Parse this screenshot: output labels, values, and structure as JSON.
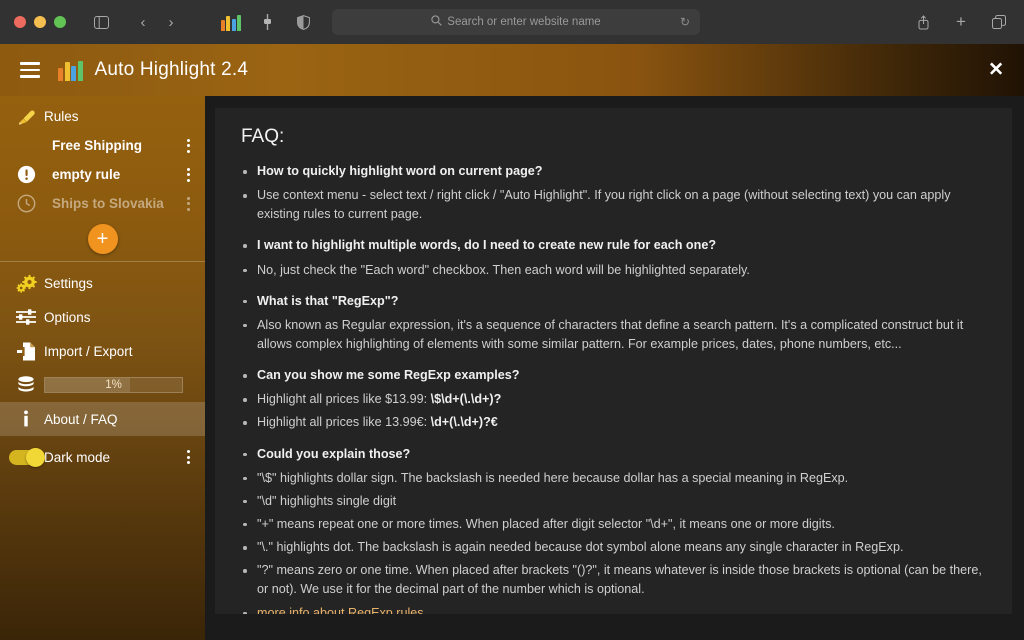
{
  "browser": {
    "search_placeholder": "Search or enter website name",
    "icons": {
      "search": "search-icon",
      "reload": "reload-icon",
      "sidebar": "sidebar-toggle-icon",
      "back": "back-arrow-icon",
      "forward": "forward-arrow-icon",
      "extension_highlighter": "highlighter-extension-icon",
      "extension_slider": "slider-extension-icon",
      "extension_shield": "shield-extension-icon",
      "share": "share-icon",
      "new_tab": "plus-icon",
      "tabs": "tab-overview-icon"
    }
  },
  "app": {
    "title": "Auto Highlight 2.4",
    "menu_label": "menu",
    "close_label": "✕"
  },
  "sidebar": {
    "rules_header": "Rules",
    "rules": [
      {
        "label": "Free Shipping",
        "state": "normal",
        "icon": "none"
      },
      {
        "label": "empty rule",
        "state": "warning",
        "icon": "exclamation-circle-icon"
      },
      {
        "label": "Ships to Slovakia",
        "state": "disabled",
        "icon": "clock-icon"
      }
    ],
    "add_label": "+",
    "items": [
      {
        "label": "Settings",
        "icon": "gears-icon"
      },
      {
        "label": "Options",
        "icon": "sliders-icon"
      },
      {
        "label": "Import / Export",
        "icon": "import-export-icon"
      }
    ],
    "storage": {
      "icon": "database-icon",
      "percent": "1%",
      "fill_ratio": 62
    },
    "about": {
      "label": "About / FAQ",
      "icon": "info-icon",
      "active": true
    },
    "dark_mode": {
      "label": "Dark mode",
      "enabled": true
    }
  },
  "faq": {
    "title": "FAQ:",
    "entries": [
      {
        "type": "q",
        "text": "How to quickly highlight word on current page?"
      },
      {
        "type": "a",
        "text": "Use context menu - select text / right click / \"Auto Highlight\". If you right click on a page (without selecting text) you can apply existing rules to current page."
      },
      {
        "type": "q",
        "text": "I want to highlight multiple words, do I need to create new rule for each one?"
      },
      {
        "type": "a",
        "text": "No, just check the \"Each word\" checkbox. Then each word will be highlighted separately."
      },
      {
        "type": "q",
        "text": "What is that \"RegExp\"?"
      },
      {
        "type": "a",
        "text": "Also known as Regular expression, it's a sequence of characters that define a search pattern. It's a complicated construct but it allows complex highlighting of elements with some similar pattern. For example prices, dates, phone numbers, etc..."
      },
      {
        "type": "q",
        "text": "Can you show me some RegExp examples?"
      },
      {
        "type": "a-code",
        "text": "Highlight all prices like $13.99: ",
        "code": "\\$\\d+(\\.\\d+)?"
      },
      {
        "type": "a-code",
        "text": "Highlight all prices like 13.99€: ",
        "code": "\\d+(\\.\\d+)?€"
      },
      {
        "type": "q",
        "text": "Could you explain those?"
      },
      {
        "type": "a",
        "text": "\"\\$\" highlights dollar sign. The backslash is needed here because dollar has a special meaning in RegExp."
      },
      {
        "type": "a",
        "text": "\"\\d\" highlights single digit"
      },
      {
        "type": "a",
        "text": "\"+\" means repeat one or more times. When placed after digit selector \"\\d+\", it means one or more digits."
      },
      {
        "type": "a",
        "text": "\"\\.\" highlights dot. The backslash is again needed because dot symbol alone means any single character in RegExp."
      },
      {
        "type": "a",
        "text": "\"?\" means zero or one time. When placed after brackets \"()?\", it means whatever is inside those brackets is optional (can be there, or not). We use it for the decimal part of the number which is optional."
      },
      {
        "type": "link",
        "text": "more info about RegExp rules"
      }
    ]
  },
  "colors": {
    "accent": "#f0941f",
    "sidebar_top": "#95610f",
    "link": "#e8b26a",
    "toggle_on": "#f2d836",
    "panel_bg": "#242424"
  }
}
